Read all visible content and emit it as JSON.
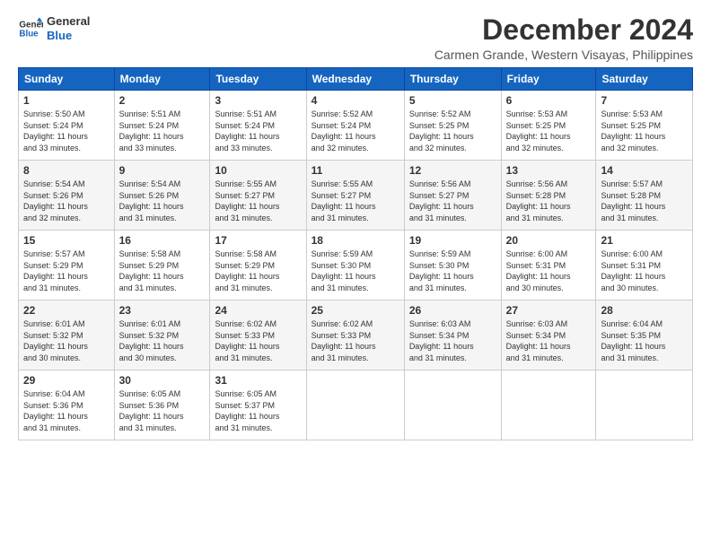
{
  "logo": {
    "line1": "General",
    "line2": "Blue"
  },
  "title": "December 2024",
  "subtitle": "Carmen Grande, Western Visayas, Philippines",
  "days_header": [
    "Sunday",
    "Monday",
    "Tuesday",
    "Wednesday",
    "Thursday",
    "Friday",
    "Saturday"
  ],
  "weeks": [
    [
      {
        "day": "1",
        "info": "Sunrise: 5:50 AM\nSunset: 5:24 PM\nDaylight: 11 hours\nand 33 minutes."
      },
      {
        "day": "2",
        "info": "Sunrise: 5:51 AM\nSunset: 5:24 PM\nDaylight: 11 hours\nand 33 minutes."
      },
      {
        "day": "3",
        "info": "Sunrise: 5:51 AM\nSunset: 5:24 PM\nDaylight: 11 hours\nand 33 minutes."
      },
      {
        "day": "4",
        "info": "Sunrise: 5:52 AM\nSunset: 5:24 PM\nDaylight: 11 hours\nand 32 minutes."
      },
      {
        "day": "5",
        "info": "Sunrise: 5:52 AM\nSunset: 5:25 PM\nDaylight: 11 hours\nand 32 minutes."
      },
      {
        "day": "6",
        "info": "Sunrise: 5:53 AM\nSunset: 5:25 PM\nDaylight: 11 hours\nand 32 minutes."
      },
      {
        "day": "7",
        "info": "Sunrise: 5:53 AM\nSunset: 5:25 PM\nDaylight: 11 hours\nand 32 minutes."
      }
    ],
    [
      {
        "day": "8",
        "info": "Sunrise: 5:54 AM\nSunset: 5:26 PM\nDaylight: 11 hours\nand 32 minutes."
      },
      {
        "day": "9",
        "info": "Sunrise: 5:54 AM\nSunset: 5:26 PM\nDaylight: 11 hours\nand 31 minutes."
      },
      {
        "day": "10",
        "info": "Sunrise: 5:55 AM\nSunset: 5:27 PM\nDaylight: 11 hours\nand 31 minutes."
      },
      {
        "day": "11",
        "info": "Sunrise: 5:55 AM\nSunset: 5:27 PM\nDaylight: 11 hours\nand 31 minutes."
      },
      {
        "day": "12",
        "info": "Sunrise: 5:56 AM\nSunset: 5:27 PM\nDaylight: 11 hours\nand 31 minutes."
      },
      {
        "day": "13",
        "info": "Sunrise: 5:56 AM\nSunset: 5:28 PM\nDaylight: 11 hours\nand 31 minutes."
      },
      {
        "day": "14",
        "info": "Sunrise: 5:57 AM\nSunset: 5:28 PM\nDaylight: 11 hours\nand 31 minutes."
      }
    ],
    [
      {
        "day": "15",
        "info": "Sunrise: 5:57 AM\nSunset: 5:29 PM\nDaylight: 11 hours\nand 31 minutes."
      },
      {
        "day": "16",
        "info": "Sunrise: 5:58 AM\nSunset: 5:29 PM\nDaylight: 11 hours\nand 31 minutes."
      },
      {
        "day": "17",
        "info": "Sunrise: 5:58 AM\nSunset: 5:29 PM\nDaylight: 11 hours\nand 31 minutes."
      },
      {
        "day": "18",
        "info": "Sunrise: 5:59 AM\nSunset: 5:30 PM\nDaylight: 11 hours\nand 31 minutes."
      },
      {
        "day": "19",
        "info": "Sunrise: 5:59 AM\nSunset: 5:30 PM\nDaylight: 11 hours\nand 31 minutes."
      },
      {
        "day": "20",
        "info": "Sunrise: 6:00 AM\nSunset: 5:31 PM\nDaylight: 11 hours\nand 30 minutes."
      },
      {
        "day": "21",
        "info": "Sunrise: 6:00 AM\nSunset: 5:31 PM\nDaylight: 11 hours\nand 30 minutes."
      }
    ],
    [
      {
        "day": "22",
        "info": "Sunrise: 6:01 AM\nSunset: 5:32 PM\nDaylight: 11 hours\nand 30 minutes."
      },
      {
        "day": "23",
        "info": "Sunrise: 6:01 AM\nSunset: 5:32 PM\nDaylight: 11 hours\nand 30 minutes."
      },
      {
        "day": "24",
        "info": "Sunrise: 6:02 AM\nSunset: 5:33 PM\nDaylight: 11 hours\nand 31 minutes."
      },
      {
        "day": "25",
        "info": "Sunrise: 6:02 AM\nSunset: 5:33 PM\nDaylight: 11 hours\nand 31 minutes."
      },
      {
        "day": "26",
        "info": "Sunrise: 6:03 AM\nSunset: 5:34 PM\nDaylight: 11 hours\nand 31 minutes."
      },
      {
        "day": "27",
        "info": "Sunrise: 6:03 AM\nSunset: 5:34 PM\nDaylight: 11 hours\nand 31 minutes."
      },
      {
        "day": "28",
        "info": "Sunrise: 6:04 AM\nSunset: 5:35 PM\nDaylight: 11 hours\nand 31 minutes."
      }
    ],
    [
      {
        "day": "29",
        "info": "Sunrise: 6:04 AM\nSunset: 5:36 PM\nDaylight: 11 hours\nand 31 minutes."
      },
      {
        "day": "30",
        "info": "Sunrise: 6:05 AM\nSunset: 5:36 PM\nDaylight: 11 hours\nand 31 minutes."
      },
      {
        "day": "31",
        "info": "Sunrise: 6:05 AM\nSunset: 5:37 PM\nDaylight: 11 hours\nand 31 minutes."
      },
      {
        "day": "",
        "info": ""
      },
      {
        "day": "",
        "info": ""
      },
      {
        "day": "",
        "info": ""
      },
      {
        "day": "",
        "info": ""
      }
    ]
  ]
}
